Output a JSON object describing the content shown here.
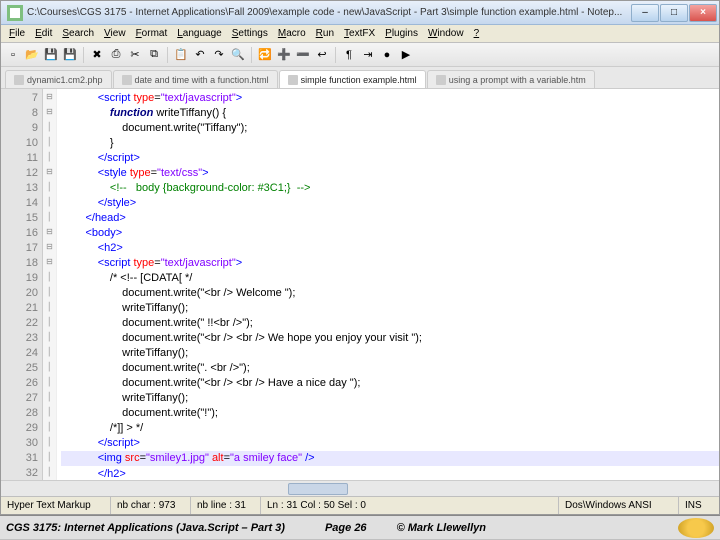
{
  "titlebar": {
    "path": "C:\\Courses\\CGS 3175 - Internet Applications\\Fall 2009\\example code - new\\JavaScript - Part 3\\simple function example.html - Notep..."
  },
  "menubar": [
    "File",
    "Edit",
    "Search",
    "View",
    "Format",
    "Language",
    "Settings",
    "Macro",
    "Run",
    "TextFX",
    "Plugins",
    "Window",
    "?"
  ],
  "tabs": [
    {
      "label": "dynamic1.cm2.php",
      "active": false
    },
    {
      "label": "date and time with a function.html",
      "active": false
    },
    {
      "label": "simple function example.html",
      "active": true
    },
    {
      "label": "using a prompt with a variable.htm",
      "active": false
    }
  ],
  "lines": [
    {
      "n": 7,
      "indent": 3,
      "tokens": [
        {
          "c": "t-ang",
          "t": "<"
        },
        {
          "c": "t-tag",
          "t": "script"
        },
        {
          "c": "t-txt",
          "t": " "
        },
        {
          "c": "t-attr",
          "t": "type"
        },
        {
          "c": "t-txt",
          "t": "="
        },
        {
          "c": "t-str",
          "t": "\"text/javascript\""
        },
        {
          "c": "t-ang",
          "t": ">"
        }
      ]
    },
    {
      "n": 8,
      "indent": 4,
      "tokens": [
        {
          "c": "t-kw",
          "t": "function"
        },
        {
          "c": "t-txt",
          "t": " writeTiffany() {"
        }
      ]
    },
    {
      "n": 9,
      "indent": 5,
      "tokens": [
        {
          "c": "t-txt",
          "t": "document.write(\"Tiffany\");"
        }
      ]
    },
    {
      "n": 10,
      "indent": 4,
      "tokens": [
        {
          "c": "t-txt",
          "t": "}"
        }
      ]
    },
    {
      "n": 11,
      "indent": 3,
      "tokens": [
        {
          "c": "t-ang",
          "t": "</"
        },
        {
          "c": "t-tag",
          "t": "script"
        },
        {
          "c": "t-ang",
          "t": ">"
        }
      ]
    },
    {
      "n": 12,
      "indent": 3,
      "tokens": [
        {
          "c": "t-ang",
          "t": "<"
        },
        {
          "c": "t-tag",
          "t": "style"
        },
        {
          "c": "t-txt",
          "t": " "
        },
        {
          "c": "t-attr",
          "t": "type"
        },
        {
          "c": "t-txt",
          "t": "="
        },
        {
          "c": "t-str",
          "t": "\"text/css\""
        },
        {
          "c": "t-ang",
          "t": ">"
        }
      ]
    },
    {
      "n": 13,
      "indent": 4,
      "tokens": [
        {
          "c": "t-com",
          "t": "<!--   body {background-color: #3C1;}  -->"
        }
      ]
    },
    {
      "n": 14,
      "indent": 3,
      "tokens": [
        {
          "c": "t-ang",
          "t": "</"
        },
        {
          "c": "t-tag",
          "t": "style"
        },
        {
          "c": "t-ang",
          "t": ">"
        }
      ]
    },
    {
      "n": 15,
      "indent": 2,
      "tokens": [
        {
          "c": "t-ang",
          "t": "</"
        },
        {
          "c": "t-tag",
          "t": "head"
        },
        {
          "c": "t-ang",
          "t": ">"
        }
      ]
    },
    {
      "n": 16,
      "indent": 2,
      "tokens": [
        {
          "c": "t-ang",
          "t": "<"
        },
        {
          "c": "t-tag",
          "t": "body"
        },
        {
          "c": "t-ang",
          "t": ">"
        }
      ]
    },
    {
      "n": 17,
      "indent": 3,
      "tokens": [
        {
          "c": "t-ang",
          "t": "<"
        },
        {
          "c": "t-tag",
          "t": "h2"
        },
        {
          "c": "t-ang",
          "t": ">"
        }
      ]
    },
    {
      "n": 18,
      "indent": 3,
      "tokens": [
        {
          "c": "t-ang",
          "t": "<"
        },
        {
          "c": "t-tag",
          "t": "script"
        },
        {
          "c": "t-txt",
          "t": " "
        },
        {
          "c": "t-attr",
          "t": "type"
        },
        {
          "c": "t-txt",
          "t": "="
        },
        {
          "c": "t-str",
          "t": "\"text/javascript\""
        },
        {
          "c": "t-ang",
          "t": ">"
        }
      ]
    },
    {
      "n": 19,
      "indent": 4,
      "tokens": [
        {
          "c": "t-txt",
          "t": "/* <!-- [CDATA[ */"
        }
      ]
    },
    {
      "n": 20,
      "indent": 5,
      "tokens": [
        {
          "c": "t-txt",
          "t": "document.write(\"<br /> Welcome \");"
        }
      ]
    },
    {
      "n": 21,
      "indent": 5,
      "tokens": [
        {
          "c": "t-txt",
          "t": "writeTiffany();"
        }
      ]
    },
    {
      "n": 22,
      "indent": 5,
      "tokens": [
        {
          "c": "t-txt",
          "t": "document.write(\" !!<br />\");"
        }
      ]
    },
    {
      "n": 23,
      "indent": 5,
      "tokens": [
        {
          "c": "t-txt",
          "t": "document.write(\"<br /> <br /> We hope you enjoy your visit \");"
        }
      ]
    },
    {
      "n": 24,
      "indent": 5,
      "tokens": [
        {
          "c": "t-txt",
          "t": "writeTiffany();"
        }
      ]
    },
    {
      "n": 25,
      "indent": 5,
      "tokens": [
        {
          "c": "t-txt",
          "t": "document.write(\". <br />\");"
        }
      ]
    },
    {
      "n": 26,
      "indent": 5,
      "tokens": [
        {
          "c": "t-txt",
          "t": "document.write(\"<br /> <br /> Have a nice day \");"
        }
      ]
    },
    {
      "n": 27,
      "indent": 5,
      "tokens": [
        {
          "c": "t-txt",
          "t": "writeTiffany();"
        }
      ]
    },
    {
      "n": 28,
      "indent": 5,
      "tokens": [
        {
          "c": "t-txt",
          "t": "document.write(\"!\");"
        }
      ]
    },
    {
      "n": 29,
      "indent": 4,
      "tokens": [
        {
          "c": "t-txt",
          "t": "/*]] > */"
        }
      ]
    },
    {
      "n": 30,
      "indent": 3,
      "tokens": [
        {
          "c": "t-ang",
          "t": "</"
        },
        {
          "c": "t-tag",
          "t": "script"
        },
        {
          "c": "t-ang",
          "t": ">"
        }
      ]
    },
    {
      "n": 31,
      "indent": 3,
      "hl": true,
      "tokens": [
        {
          "c": "t-ang",
          "t": "<"
        },
        {
          "c": "t-tag",
          "t": "img"
        },
        {
          "c": "t-txt",
          "t": " "
        },
        {
          "c": "t-attr",
          "t": "src"
        },
        {
          "c": "t-txt",
          "t": "="
        },
        {
          "c": "t-str",
          "t": "\"smiley1.jpg\""
        },
        {
          "c": "t-txt",
          "t": " "
        },
        {
          "c": "t-attr",
          "t": "alt"
        },
        {
          "c": "t-txt",
          "t": "="
        },
        {
          "c": "t-str",
          "t": "\"a smiley face\""
        },
        {
          "c": "t-txt",
          "t": " "
        },
        {
          "c": "t-ang",
          "t": "/>"
        }
      ]
    },
    {
      "n": 32,
      "indent": 3,
      "tokens": [
        {
          "c": "t-ang",
          "t": "</"
        },
        {
          "c": "t-tag",
          "t": "h2"
        },
        {
          "c": "t-ang",
          "t": ">"
        }
      ]
    }
  ],
  "status": {
    "lang": "Hyper Text Markup",
    "chars": "nb char : 973",
    "lines": "nb line : 31",
    "pos": "Ln : 31   Col : 50   Sel : 0",
    "enc": "Dos\\Windows  ANSI",
    "mode": "INS"
  },
  "footer": {
    "course": "CGS 3175: Internet Applications (Java.Script – Part 3)",
    "page": "Page 26",
    "author": "© Mark Llewellyn"
  },
  "toolbar_icons": [
    "new",
    "open",
    "save",
    "saveall",
    "close",
    "print",
    "cut",
    "copy",
    "paste",
    "undo",
    "redo",
    "find",
    "replace",
    "zoom-in",
    "zoom-out",
    "wrap",
    "show-all",
    "indent",
    "rec",
    "play"
  ]
}
